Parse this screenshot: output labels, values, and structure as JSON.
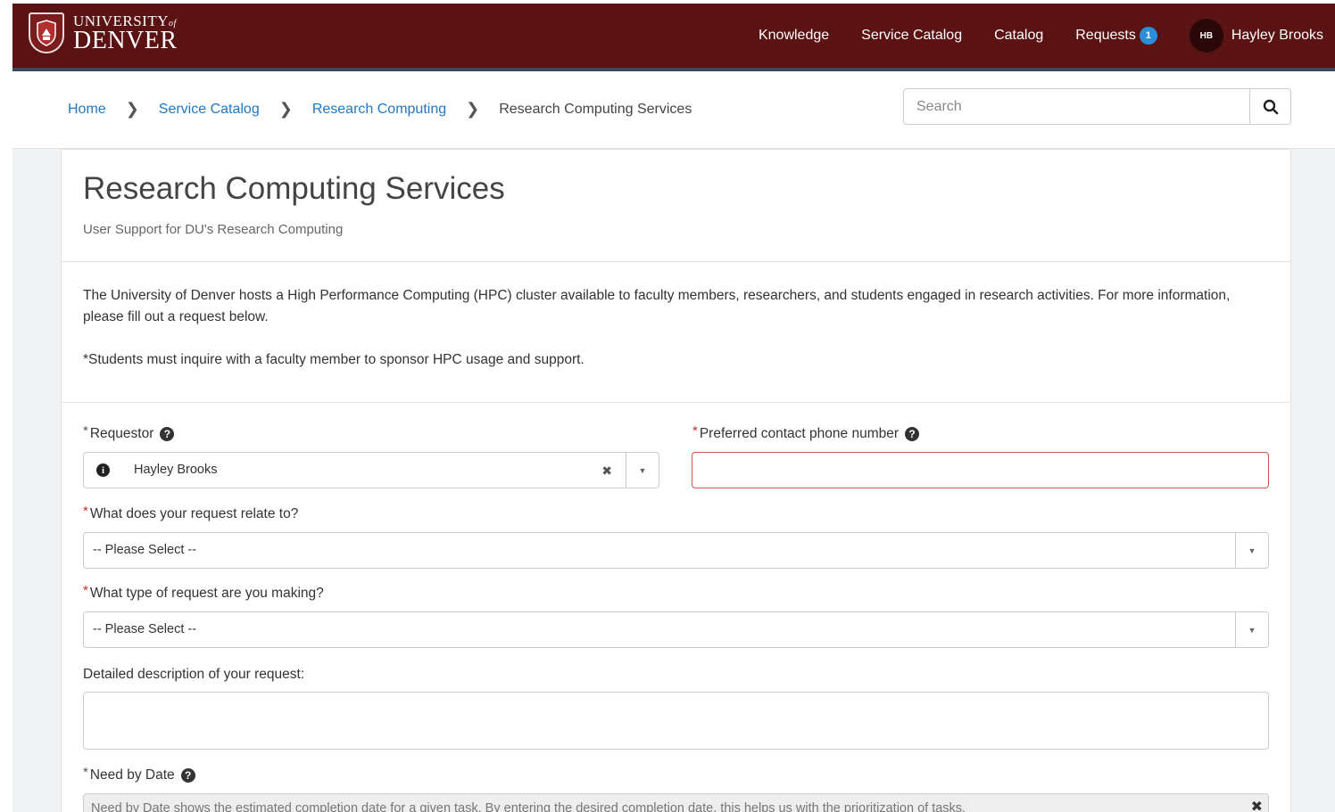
{
  "header": {
    "logo_top": "UNIVERSITY",
    "logo_of": "of",
    "logo_bottom": "DENVER",
    "nav": [
      "Knowledge",
      "Service Catalog",
      "Catalog",
      "Requests"
    ],
    "requests_badge": "1",
    "user_initials": "HB",
    "user_name": "Hayley Brooks",
    "colors": {
      "header_bg": "#5b1212",
      "link": "#1f78c1",
      "badge": "#2a8fd6",
      "required": "#c9302c"
    }
  },
  "breadcrumb": {
    "items": [
      "Home",
      "Service Catalog",
      "Research Computing"
    ],
    "current": "Research Computing Services"
  },
  "search": {
    "placeholder": "Search",
    "icon": "search-icon"
  },
  "page": {
    "title": "Research Computing Services",
    "subtitle": "User Support for DU's Research Computing",
    "description": "The University of Denver hosts a High Performance Computing (HPC) cluster available to faculty members, researchers, and students engaged in research activities. For more information, please fill out a request below.",
    "note": "*Students must inquire with a faculty member to sponsor HPC usage and support."
  },
  "form": {
    "requestor": {
      "label": "Requestor",
      "value": "Hayley Brooks"
    },
    "phone": {
      "label": "Preferred contact phone number",
      "value": ""
    },
    "relate": {
      "label": "What does your request relate to?",
      "value": "-- Please Select --"
    },
    "type": {
      "label": "What type of request are you making?",
      "value": "-- Please Select --"
    },
    "description": {
      "label": "Detailed description of your request:",
      "value": ""
    },
    "need_by": {
      "label": "Need by Date",
      "placeholder": "Need by Date shows the estimated completion date for a given task. By entering the desired completion date, this helps us with the prioritization of tasks."
    }
  }
}
